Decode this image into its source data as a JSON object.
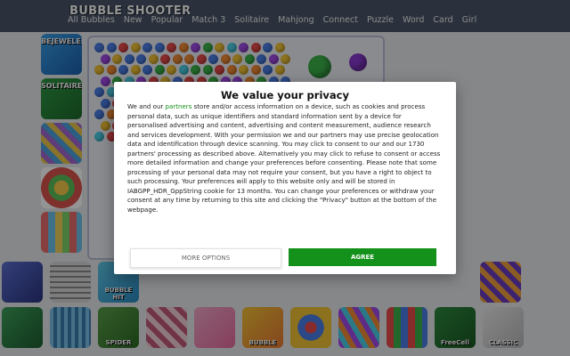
{
  "header": {
    "logo": "BUBBLE SHOOTER",
    "nav": [
      "All Bubbles",
      "New",
      "Popular",
      "Match 3",
      "Solitaire",
      "Mahjong",
      "Connect",
      "Puzzle",
      "Word",
      "Card",
      "Girl"
    ]
  },
  "thumbnails": {
    "side": [
      {
        "label": "BEJEWELED",
        "icon": "gem-icon"
      },
      {
        "label": "SOLITAIRE",
        "icon": "cards-icon"
      },
      {
        "label": "",
        "icon": "tiles-icon"
      },
      {
        "label": "",
        "icon": "hex-icon"
      },
      {
        "label": "",
        "icon": "blocks-icon"
      }
    ],
    "bottom_row_1": [
      {
        "label": "",
        "icon": "tree-icon"
      },
      {
        "label": "",
        "icon": "maze-icon"
      },
      {
        "label": "BUBBLE HIT",
        "icon": "bubble-icon"
      },
      {
        "label": "",
        "icon": "tiles-icon"
      }
    ],
    "bottom_row_2": [
      {
        "label": "",
        "icon": "house-icon"
      },
      {
        "label": "",
        "icon": "maze-icon"
      },
      {
        "label": "SPIDER",
        "icon": "cards-icon"
      },
      {
        "label": "",
        "icon": "faces-icon"
      },
      {
        "label": "",
        "icon": "cats-icon"
      },
      {
        "label": "BUBBLE",
        "icon": "bubble-icon"
      },
      {
        "label": "",
        "icon": "bubbles-icon"
      },
      {
        "label": "",
        "icon": "hex-icon"
      },
      {
        "label": "",
        "icon": "blocks-icon"
      },
      {
        "label": "FreeCell",
        "icon": "cards-icon"
      },
      {
        "label": "CLASSIC",
        "icon": "mahjong-icon"
      }
    ]
  },
  "dialog": {
    "title": "We value your privacy",
    "body_before_link": "We and our ",
    "link_text": "partners",
    "body_after_link": " store and/or access information on a device, such as cookies and process personal data, such as unique identifiers and standard information sent by a device for personalised advertising and content, advertising and content measurement, audience research and services development. With your permission we and our partners may use precise geolocation data and identification through device scanning. You may click to consent to our and our 1730 partners' processing as described above. Alternatively you may click to refuse to consent or access more detailed information and change your preferences before consenting. Please note that some processing of your personal data may not require your consent, but you have a right to object to such processing. Your preferences will apply to this website only and will be stored in IABGPP_HDR_GppString cookie for 13 months. You can change your preferences or withdraw your consent at any time by returning to this site and clicking the \"Privacy\" button at the bottom of the webpage.",
    "more_options": "MORE OPTIONS",
    "agree": "AGREE"
  },
  "colors": {
    "header_bg": "#4a5568",
    "agree_green": "#14911a",
    "link_green": "#14911a"
  }
}
